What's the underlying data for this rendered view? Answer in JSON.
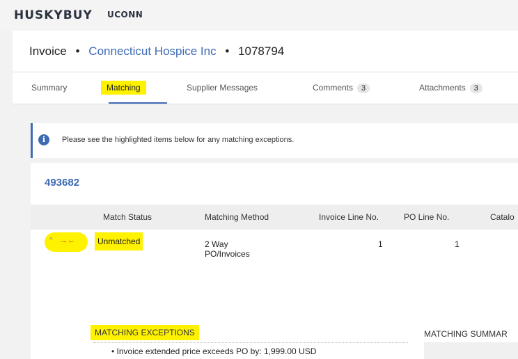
{
  "topbar": {
    "brand": "HUSKYBUY",
    "org": "UCONN"
  },
  "header": {
    "doc_type": "Invoice",
    "separator": "•",
    "supplier": "Connecticut Hospice Inc",
    "invoice_number": "1078794"
  },
  "tabs": [
    {
      "label": "Summary"
    },
    {
      "label": "Matching"
    },
    {
      "label": "Supplier Messages"
    },
    {
      "label": "Comments",
      "count": "3"
    },
    {
      "label": "Attachments",
      "count": "3"
    }
  ],
  "alert": {
    "icon": "info-icon",
    "icon_glyph": "i",
    "text": "Please see the highlighted items below for any matching exceptions."
  },
  "po": {
    "number": "493682"
  },
  "table": {
    "headers": [
      "Match Status",
      "Matching Method",
      "Invoice Line No.",
      "PO Line No.",
      "Catalo"
    ],
    "row": {
      "expand_glyph": "^",
      "mismatch_glyph": "→←",
      "status": "Unmatched",
      "method_line1": "2 Way",
      "method_line2": "PO/Invoices",
      "invoice_line": "1",
      "po_line": "1"
    }
  },
  "exceptions": {
    "title": "MATCHING EXCEPTIONS",
    "items": [
      "Invoice extended price exceeds PO by: 1,999.00 USD"
    ]
  },
  "summary": {
    "title": "MATCHING SUMMAR"
  },
  "colors": {
    "accent": "#3e6bb4",
    "highlight": "#fff200",
    "mismatch": "#e0202a"
  }
}
